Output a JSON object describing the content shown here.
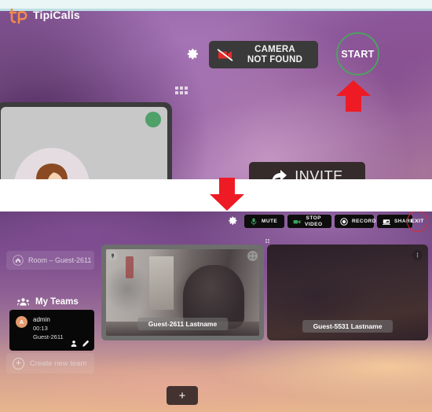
{
  "panel_one": {
    "settings_icon": "gear-icon",
    "camera_status": {
      "line1": "CAMERA",
      "line2": "NOT FOUND",
      "icon": "camera-off-icon"
    },
    "start_button": "START",
    "drag_handle": "grid-dots-icon",
    "self_view": {
      "avatar": "person-avatar-icon",
      "status_dot": "online-status-dot"
    },
    "invite_button": {
      "label": "INVITE",
      "icon": "share-arrow-icon"
    },
    "annotations": {
      "up_arrow": "red-up-arrow",
      "down_arrow": "red-down-arrow"
    }
  },
  "panel_two": {
    "brand": {
      "logo": "tp",
      "name": "TipiCalls",
      "caret": "▾"
    },
    "toolbar": {
      "settings_icon": "gear-icon",
      "buttons": [
        {
          "label": "MUTE",
          "icon": "microphone-icon",
          "icon_color": "#3da35d"
        },
        {
          "label": "STOP\nVIDEO",
          "icon": "video-camera-icon",
          "icon_color": "#3da35d"
        },
        {
          "label": "RECORD",
          "icon": "record-circle-icon",
          "icon_color": "#ffffff"
        },
        {
          "label": "SHARE",
          "icon": "screen-share-icon",
          "icon_color": "#ffffff"
        }
      ],
      "exit": {
        "label": "EXIT",
        "highlight_color": "#e32b2b"
      }
    },
    "sidebar": {
      "room": {
        "label": "Room – Guest-2611",
        "icon": "home-icon"
      },
      "teams_header": {
        "label": "My Teams",
        "icon": "people-icon"
      },
      "member": {
        "initial": "A",
        "name": "admin",
        "duration": "00:13",
        "room": "Guest-2611",
        "actions": [
          {
            "icon": "add-people-icon"
          },
          {
            "icon": "edit-pencil-icon"
          }
        ]
      },
      "create_team": {
        "label": "Create new team",
        "icon": "plus-circle-icon"
      }
    },
    "tiles": [
      {
        "label": "Guest-2611 Lastname",
        "left_icon": "pin-icon",
        "right_icon": "expand-icon"
      },
      {
        "label": "Guest-5531 Lastname",
        "right_icon": "more-icon"
      }
    ],
    "add_participant_button": "+"
  },
  "colors": {
    "accent_green": "#4f9f62",
    "accent_red": "#e32b2b",
    "brand_orange": "#f08a4b",
    "toolbar_bg": "#0d0d0d"
  }
}
